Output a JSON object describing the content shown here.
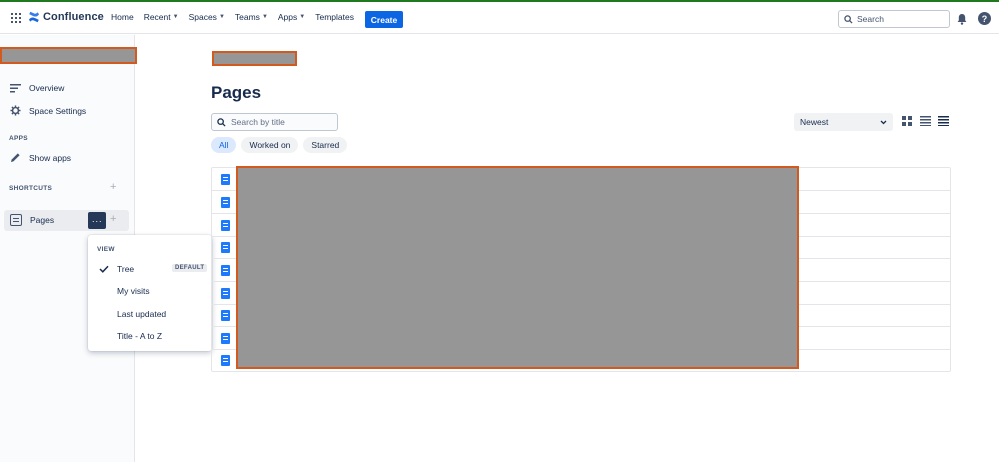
{
  "app": {
    "name": "Confluence"
  },
  "topnav": {
    "items": [
      {
        "label": "Home",
        "has_chevron": false
      },
      {
        "label": "Recent",
        "has_chevron": true
      },
      {
        "label": "Spaces",
        "has_chevron": true
      },
      {
        "label": "Teams",
        "has_chevron": true
      },
      {
        "label": "Apps",
        "has_chevron": true
      },
      {
        "label": "Templates",
        "has_chevron": false
      }
    ],
    "create_label": "Create",
    "search_placeholder": "Search"
  },
  "sidebar": {
    "overview_label": "Overview",
    "space_settings_label": "Space Settings",
    "apps_heading": "APPS",
    "show_apps_label": "Show apps",
    "shortcuts_heading": "SHORTCUTS",
    "pages_label": "Pages",
    "more_glyph": "···",
    "add_glyph": "+"
  },
  "dropdown": {
    "heading": "VIEW",
    "items": [
      {
        "label": "Tree",
        "checked": true,
        "badge": "DEFAULT"
      },
      {
        "label": "My visits",
        "checked": false
      },
      {
        "label": "Last updated",
        "checked": false
      },
      {
        "label": "Title - A to Z",
        "checked": false
      }
    ]
  },
  "main": {
    "title": "Pages",
    "search_placeholder": "Search by title",
    "filters": [
      {
        "label": "All",
        "active": true
      },
      {
        "label": "Worked on",
        "active": false
      },
      {
        "label": "Starred",
        "active": false
      }
    ],
    "sort_label": "Newest",
    "row_count": 9
  },
  "colors": {
    "primary": "#0c66e4",
    "redaction_fill": "#969696",
    "redaction_border": "#d35a1e",
    "page_icon": "#1d7afc"
  }
}
